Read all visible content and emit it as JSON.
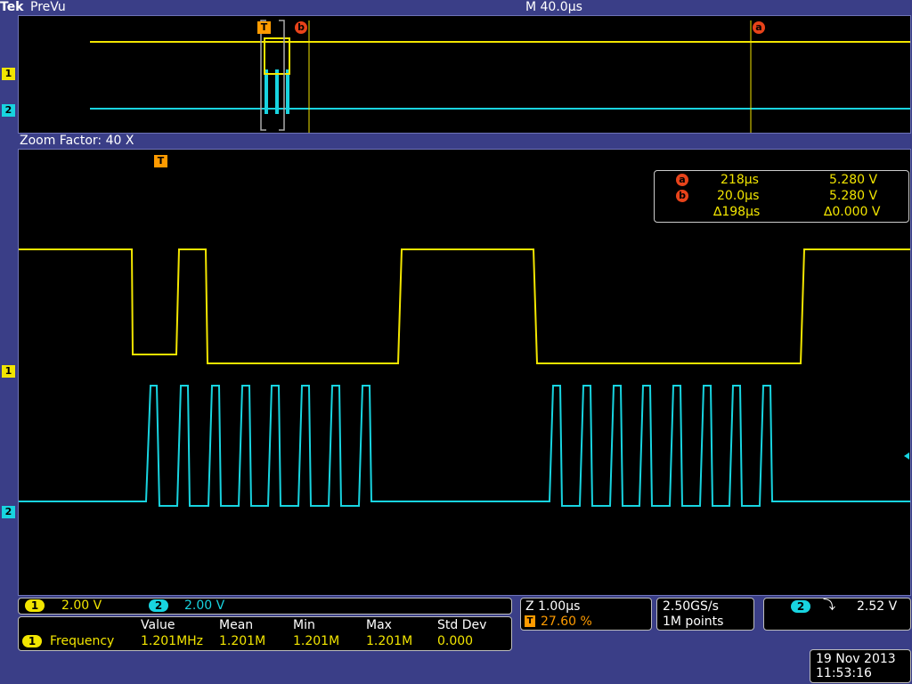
{
  "topbar": {
    "brand": "Tek",
    "mode": "PreVu",
    "horizontal_scale": "M 40.0µs"
  },
  "overview": {
    "trigger_marker": "T",
    "cursor_a": "a",
    "cursor_b": "b"
  },
  "zoom_label": "Zoom Factor: 40 X",
  "channel_markers": {
    "ch1": "1",
    "ch2": "2"
  },
  "cursor_readout": {
    "a": {
      "label": "a",
      "time": "218µs",
      "voltage": "5.280 V"
    },
    "b": {
      "label": "b",
      "time": "20.0µs",
      "voltage": "5.280 V"
    },
    "delta": {
      "time": "∆198µs",
      "voltage": "∆0.000 V"
    }
  },
  "channels": {
    "ch1": {
      "label": "1",
      "scale": "2.00 V",
      "color": "#f2e500"
    },
    "ch2": {
      "label": "2",
      "scale": "2.00 V",
      "color": "#18d4e0"
    }
  },
  "measurements": {
    "headers": [
      "Value",
      "Mean",
      "Min",
      "Max",
      "Std Dev"
    ],
    "rows": [
      {
        "channel": "1",
        "name": "Frequency",
        "value": "1.201MHz",
        "mean": "1.201M",
        "min": "1.201M",
        "max": "1.201M",
        "std": "0.000"
      }
    ]
  },
  "zoom_settings": {
    "zoom": "Z 1.00µs",
    "trigger_marker": "T",
    "trigger_position": "27.60 %"
  },
  "acquisition": {
    "sample_rate": "2.50GS/s",
    "record_length": "1M points"
  },
  "trigger": {
    "source": "2",
    "slope_symbol": "⤵",
    "level": "2.52 V"
  },
  "datetime": {
    "date": "19 Nov 2013",
    "time": "11:53:16"
  }
}
